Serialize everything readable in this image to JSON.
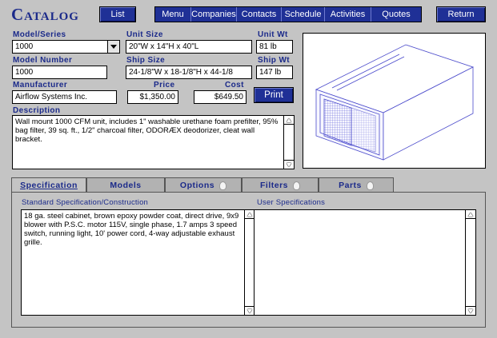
{
  "header": {
    "brand": "Catalog",
    "list_button": "List",
    "menu": [
      "Menu",
      "Companies",
      "Contacts",
      "Schedule",
      "Activities",
      "Quotes"
    ],
    "return_button": "Return"
  },
  "product": {
    "model_series_label": "Model/Series",
    "model_series_value": "1000",
    "unit_size_label": "Unit Size",
    "unit_size_value": "20\"W x 14\"H x 40\"L",
    "unit_wt_label": "Unit Wt",
    "unit_wt_value": "81 lb",
    "model_number_label": "Model Number",
    "model_number_value": "1000",
    "ship_size_label": "Ship Size",
    "ship_size_value": "24-1/8\"W x 18-1/8\"H x 44-1/8",
    "ship_wt_label": "Ship Wt",
    "ship_wt_value": "147 lb",
    "manufacturer_label": "Manufacturer",
    "manufacturer_value": "Airflow Systems Inc.",
    "price_label": "Price",
    "price_value": "$1,350.00",
    "cost_label": "Cost",
    "cost_value": "$649.50",
    "print_button": "Print",
    "description_label": "Description",
    "description_value": "Wall mount 1000 CFM unit, includes 1\" washable urethane foam prefilter, 95% bag filter, 39 sq. ft., 1/2\" charcoal filter, ODORÆX deodorizer, cleat wall bracket."
  },
  "tabs": [
    {
      "label": "Specification",
      "active": true,
      "bulb": false
    },
    {
      "label": "Models",
      "active": false,
      "bulb": false
    },
    {
      "label": "Options",
      "active": false,
      "bulb": true
    },
    {
      "label": "Filters",
      "active": false,
      "bulb": true
    },
    {
      "label": "Parts",
      "active": false,
      "bulb": true
    }
  ],
  "spec": {
    "standard_label": "Standard Specification/Construction",
    "standard_value": "18 ga. steel cabinet, brown epoxy powder coat, direct drive, 9x9 blower with P.S.C. motor 115V, single phase, 1.7 amps 3 speed switch, running light, 10' power cord, 4-way adjustable exhaust grille.",
    "user_label": "User Specifications",
    "user_value": ""
  },
  "colors": {
    "background": "#c4c4c4",
    "accent_blue": "#1f3096",
    "label_blue": "#1b2a8a"
  }
}
